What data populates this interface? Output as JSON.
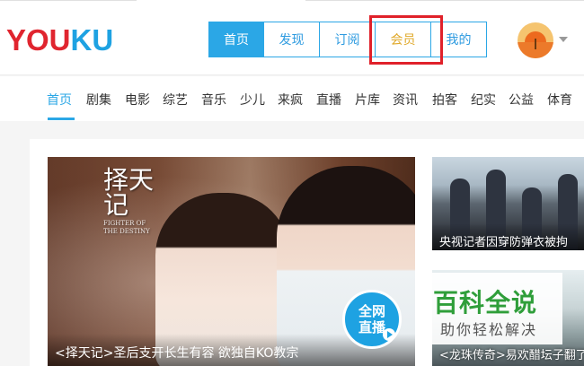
{
  "header": {
    "logo": {
      "part1": "YOU",
      "part2": "KU"
    },
    "tabs": [
      {
        "label": "首页",
        "active": true
      },
      {
        "label": "发现",
        "active": false
      },
      {
        "label": "订阅",
        "active": false
      },
      {
        "label": "会员",
        "active": false
      },
      {
        "label": "我的",
        "active": false
      }
    ],
    "avatar_icon": "user-avatar-icon",
    "menu_icon": "chevron-down-icon"
  },
  "channels": {
    "items": [
      "首页",
      "剧集",
      "电影",
      "综艺",
      "音乐",
      "少儿",
      "来疯",
      "直播",
      "片库",
      "资讯",
      "拍客",
      "纪实",
      "公益",
      "体育"
    ],
    "active_index": 0
  },
  "main_banner": {
    "poster_title": "择天记",
    "poster_subtitle": "FIGHTER OF THE DESTINY",
    "caption": "<择天记>圣后支开长生有容 欲独自KO教宗",
    "badge_line1": "全网",
    "badge_line2": "直播"
  },
  "side_items": [
    {
      "caption": "央视记者因穿防弹衣被拘"
    },
    {
      "caption": "<龙珠传奇>易欢醋坛子翻了"
    }
  ],
  "watermark": {
    "title": "百科全说",
    "subtitle": "助你轻松解决"
  },
  "colors": {
    "accent_blue": "#2ba7e6",
    "logo_red": "#e0252f",
    "logo_blue": "#1ea2e2",
    "highlight_red": "#e0212a",
    "vip_gold": "#e0a92a"
  }
}
